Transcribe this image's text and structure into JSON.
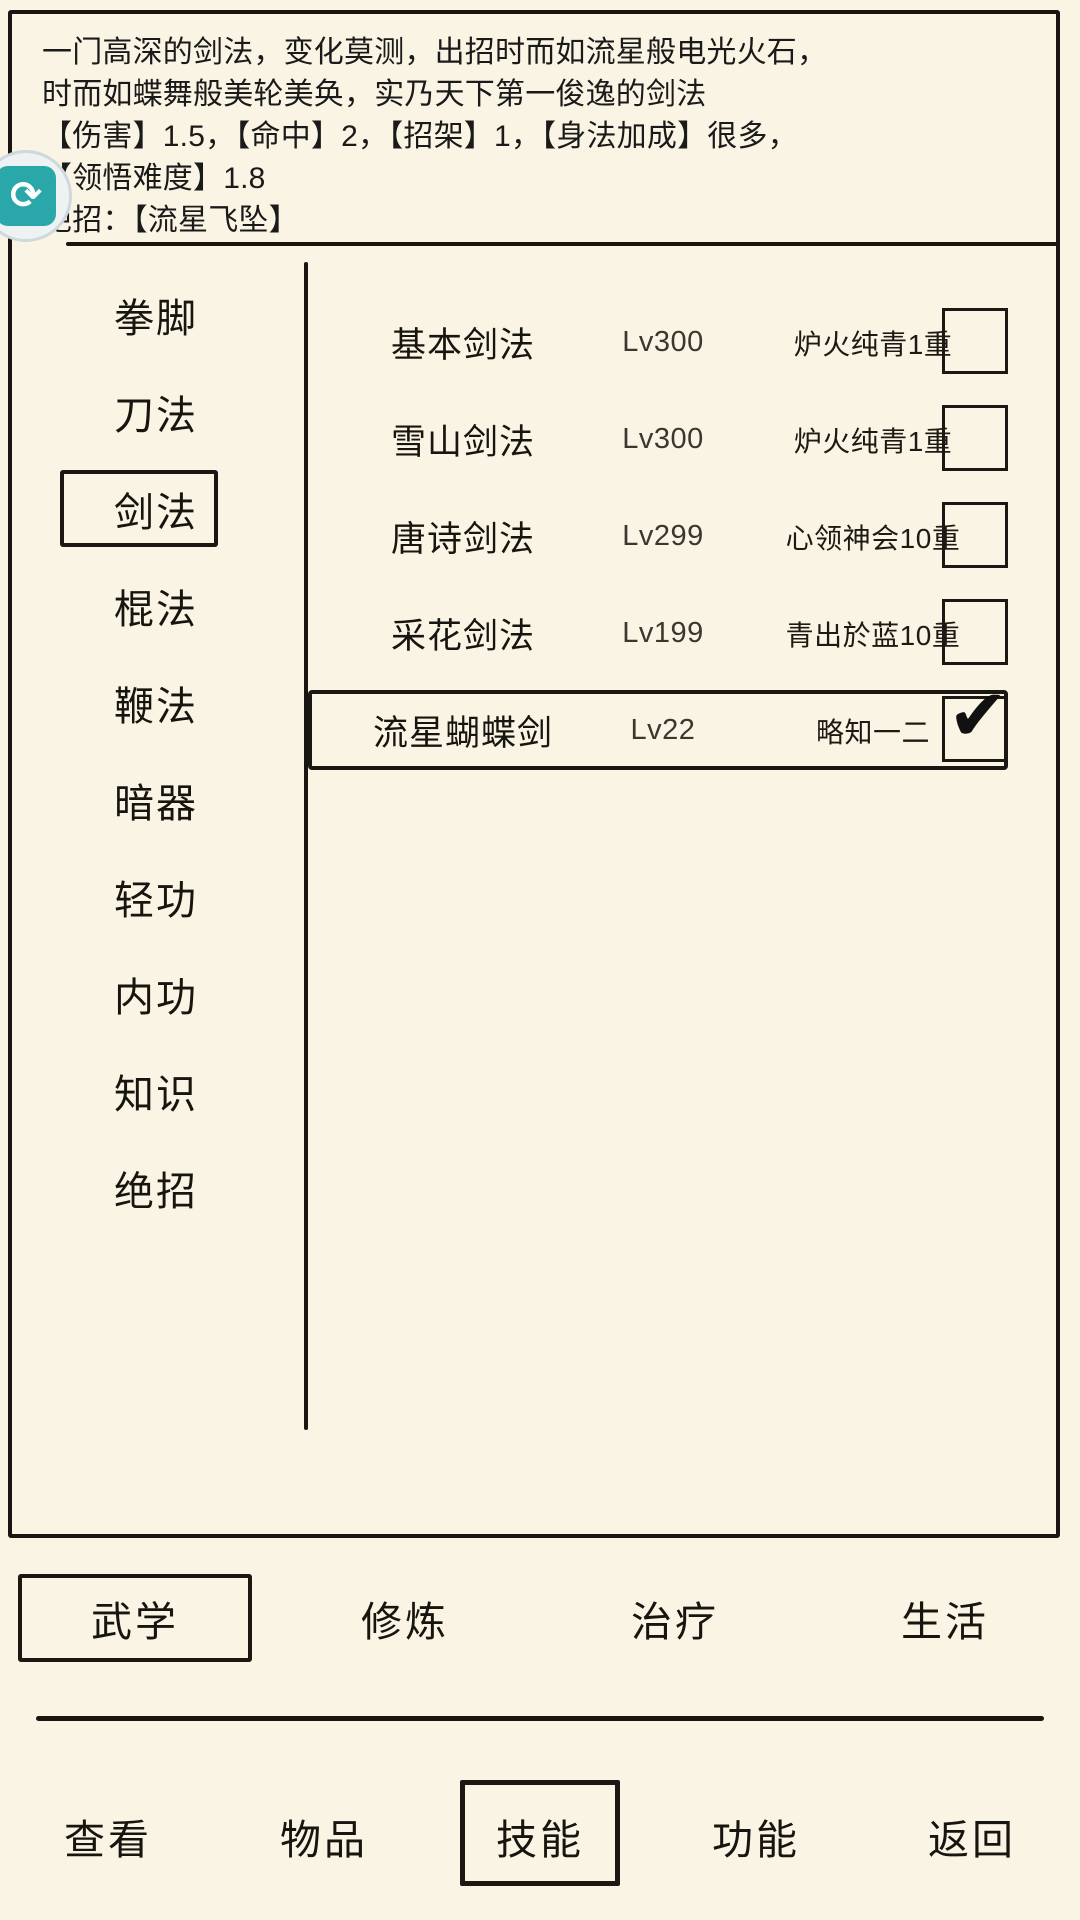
{
  "description": {
    "lines": [
      "一门高深的剑法，变化莫测，出招时而如流星般电光火石，",
      "时而如蝶舞般美轮美奂，实乃天下第一俊逸的剑法",
      "【伤害】1.5，【命中】2，【招架】1，【身法加成】很多，",
      "【领悟难度】1.8",
      "绝招：【流星飞坠】"
    ]
  },
  "refresh": {
    "icon": "refresh-icon",
    "glyph": "⟳"
  },
  "sidebar": {
    "items": [
      {
        "label": "拳脚",
        "selected": false
      },
      {
        "label": "刀法",
        "selected": false
      },
      {
        "label": "剑法",
        "selected": true
      },
      {
        "label": "棍法",
        "selected": false
      },
      {
        "label": "鞭法",
        "selected": false
      },
      {
        "label": "暗器",
        "selected": false
      },
      {
        "label": "轻功",
        "selected": false
      },
      {
        "label": "内功",
        "selected": false
      },
      {
        "label": "知识",
        "selected": false
      },
      {
        "label": "绝招",
        "selected": false
      }
    ]
  },
  "skills": {
    "rows": [
      {
        "name": "基本剑法",
        "level": "Lv300",
        "rank": "炉火纯青1重",
        "checked": false,
        "selected": false
      },
      {
        "name": "雪山剑法",
        "level": "Lv300",
        "rank": "炉火纯青1重",
        "checked": false,
        "selected": false
      },
      {
        "name": "唐诗剑法",
        "level": "Lv299",
        "rank": "心领神会10重",
        "checked": false,
        "selected": false
      },
      {
        "name": "采花剑法",
        "level": "Lv199",
        "rank": "青出於蓝10重",
        "checked": false,
        "selected": false
      },
      {
        "name": "流星蝴蝶剑",
        "level": "Lv22",
        "rank": "略知一二",
        "checked": true,
        "selected": true
      }
    ],
    "check_glyph": "✔"
  },
  "tabs": {
    "items": [
      {
        "label": "武学",
        "selected": true
      },
      {
        "label": "修炼",
        "selected": false
      },
      {
        "label": "治疗",
        "selected": false
      },
      {
        "label": "生活",
        "selected": false
      }
    ]
  },
  "bottom_nav": {
    "items": [
      {
        "label": "查看",
        "selected": false
      },
      {
        "label": "物品",
        "selected": false
      },
      {
        "label": "技能",
        "selected": true
      },
      {
        "label": "功能",
        "selected": false
      },
      {
        "label": "返回",
        "selected": false
      }
    ]
  },
  "colors": {
    "background": "#FAF4E4",
    "ink": "#191612",
    "accent": "#2aa7a8"
  }
}
